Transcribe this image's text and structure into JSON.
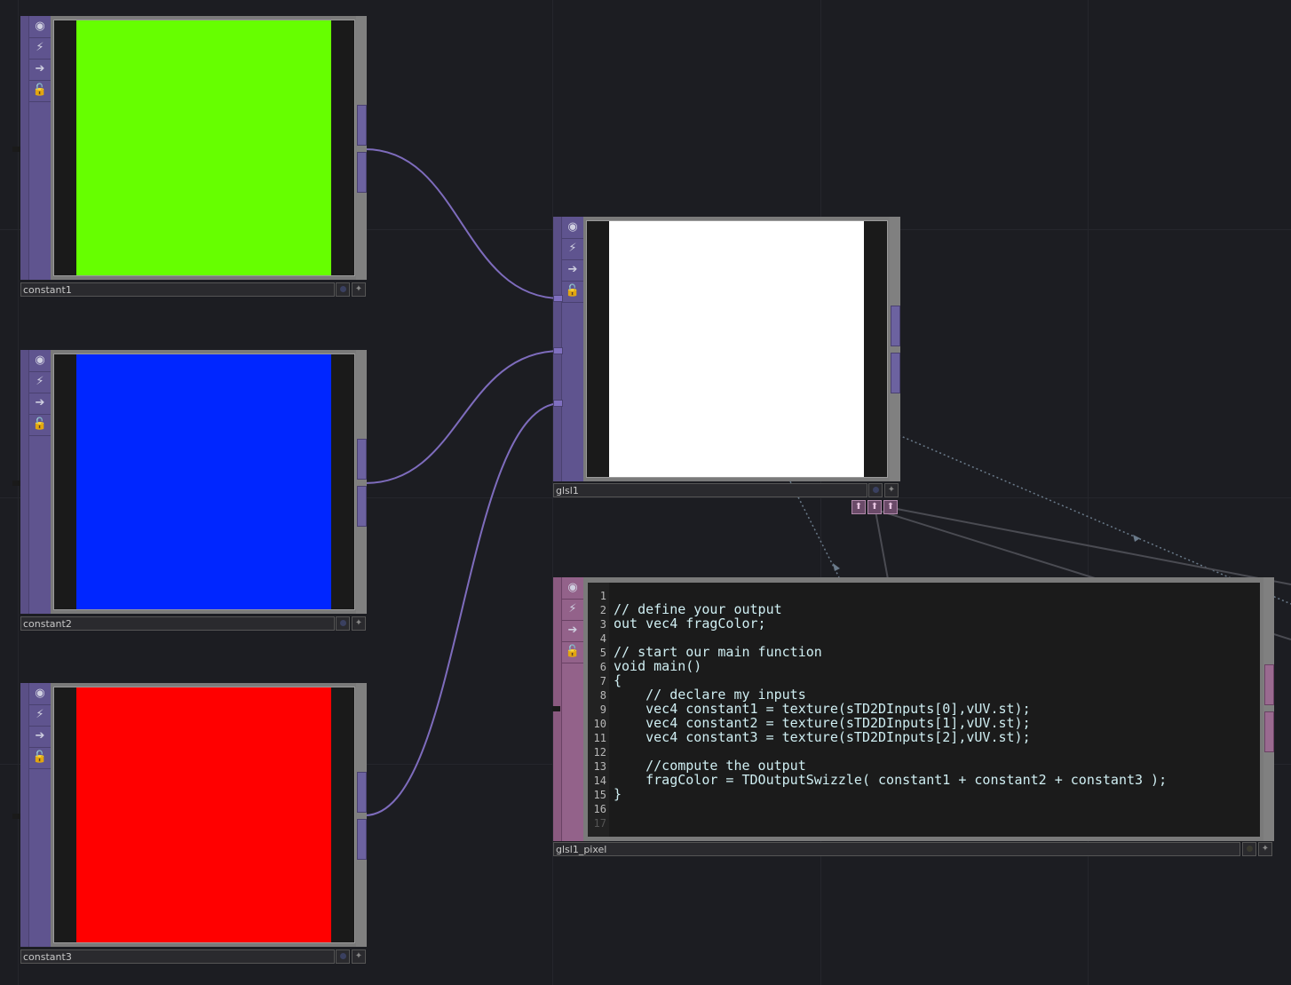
{
  "nodes": {
    "constant1": {
      "label": "constant1",
      "color": "#66ff00"
    },
    "constant2": {
      "label": "constant2",
      "color": "#0026ff"
    },
    "constant3": {
      "label": "constant3",
      "color": "#ff0000"
    },
    "glsl1": {
      "label": "glsl1",
      "color": "#ffffff"
    },
    "glsl1_pixel": {
      "label": "glsl1_pixel"
    }
  },
  "icons": [
    "view-icon",
    "bypass-icon",
    "export-icon",
    "lock-icon"
  ],
  "code_lines": [
    {
      "n": "1",
      "text": ""
    },
    {
      "n": "2",
      "text": "// define your output"
    },
    {
      "n": "3",
      "text": "out vec4 fragColor;"
    },
    {
      "n": "4",
      "text": ""
    },
    {
      "n": "5",
      "text": "// start our main function"
    },
    {
      "n": "6",
      "text": "void main()"
    },
    {
      "n": "7",
      "text": "{"
    },
    {
      "n": "8",
      "text": "    // declare my inputs"
    },
    {
      "n": "9",
      "text": "    vec4 constant1 = texture(sTD2DInputs[0],vUV.st);"
    },
    {
      "n": "10",
      "text": "    vec4 constant2 = texture(sTD2DInputs[1],vUV.st);"
    },
    {
      "n": "11",
      "text": "    vec4 constant3 = texture(sTD2DInputs[2],vUV.st);"
    },
    {
      "n": "12",
      "text": ""
    },
    {
      "n": "13",
      "text": "    //compute the output"
    },
    {
      "n": "14",
      "text": "    fragColor = TDOutputSwizzle( constant1 + constant2 + constant3 );"
    },
    {
      "n": "15",
      "text": "}"
    },
    {
      "n": "16",
      "text": ""
    },
    {
      "n": "17",
      "text": ""
    }
  ],
  "colors": {
    "wire": "#7e6cbd",
    "background": "#1c1d22"
  }
}
